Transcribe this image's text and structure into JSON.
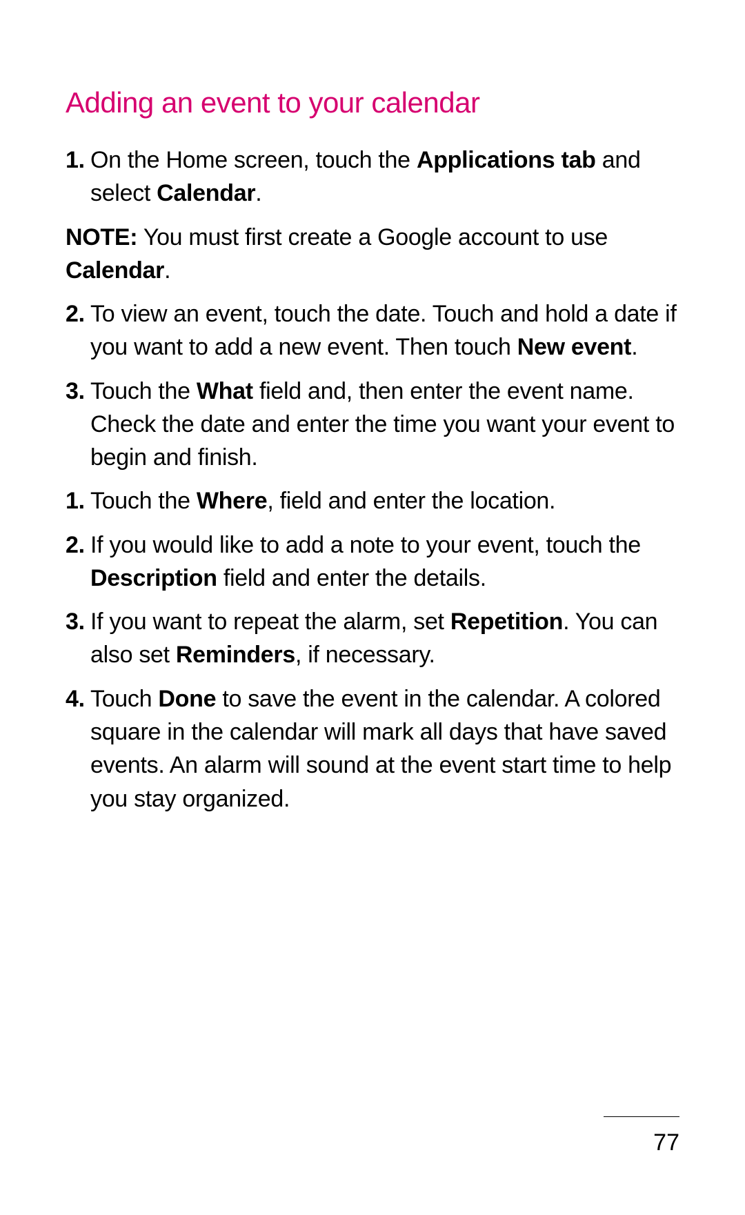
{
  "heading": "Adding an event to your calendar",
  "listA": {
    "item1": {
      "num": "1.",
      "pre": "On the Home screen, touch the ",
      "b1": "Applications tab",
      "mid": " and select ",
      "b2": "Calendar",
      "post": "."
    }
  },
  "note": {
    "label": "NOTE:",
    "pre": " You must first create a Google account to use ",
    "b1": "Calendar",
    "post": "."
  },
  "listB": {
    "item2": {
      "num": "2.",
      "pre": "To view an event, touch the date. Touch and hold a date if you want to add a new event. Then touch ",
      "b1": "New event",
      "post": "."
    },
    "item3": {
      "num": "3.",
      "pre": "Touch the ",
      "b1": "What",
      "post": " field and, then enter the event name. Check the date and enter the time you want your event to begin and finish."
    }
  },
  "listC": {
    "item1": {
      "num": "1.",
      "pre": "Touch the ",
      "b1": "Where",
      "post": ", field and enter the location."
    },
    "item2": {
      "num": "2.",
      "pre": "If you would like to add a note to your event, touch the ",
      "b1": "Description",
      "post": " field and enter the details."
    },
    "item3": {
      "num": "3.",
      "pre": "If you want to repeat the alarm, set ",
      "b1": "Repetition",
      "mid": ". You can also set ",
      "b2": "Reminders",
      "post": ", if necessary."
    },
    "item4": {
      "num": "4.",
      "pre": "Touch ",
      "b1": "Done",
      "post": " to save the event in the calendar. A colored square in the calendar will mark all days that have saved events. An alarm will sound at the event start time to help you stay organized."
    }
  },
  "pageNumber": "77"
}
